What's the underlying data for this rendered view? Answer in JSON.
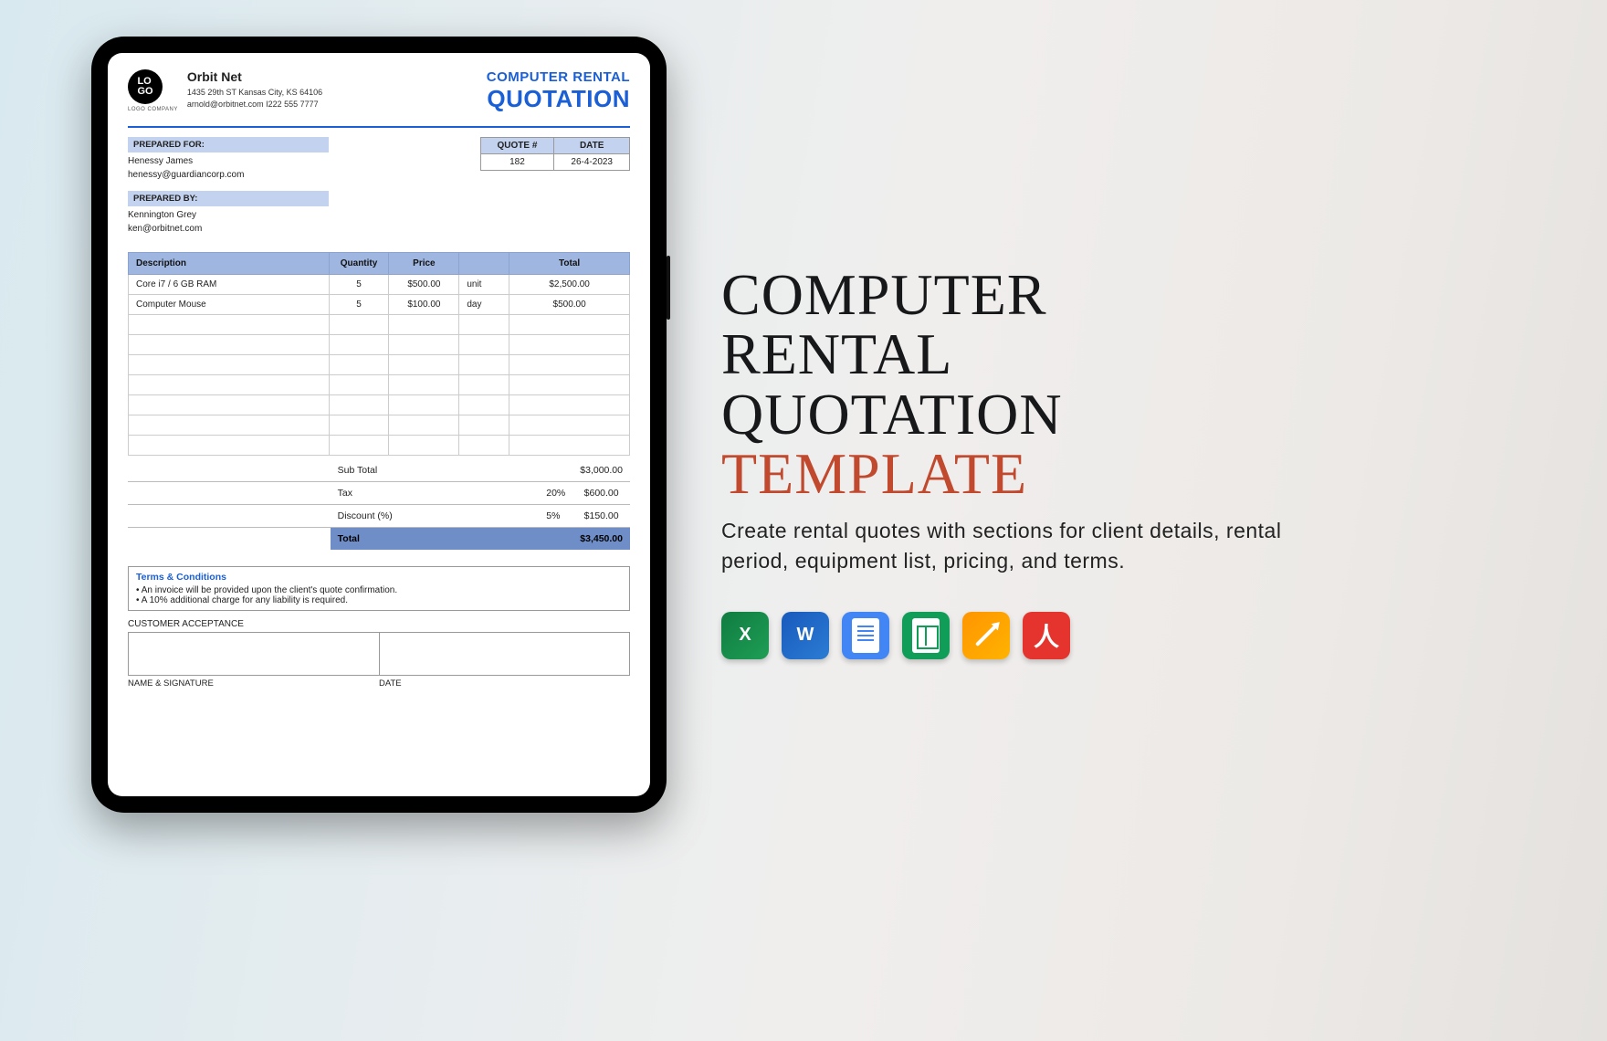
{
  "company": {
    "logo_top": "LO",
    "logo_bottom": "GO",
    "logo_caption": "LOGO COMPANY",
    "name": "Orbit Net",
    "address": "1435 29th ST Kansas City, KS 64106",
    "contact": "arnold@orbitnet.com I222 555 7777"
  },
  "title": {
    "small": "COMPUTER RENTAL",
    "big": "QUOTATION"
  },
  "prepared_for": {
    "label": "PREPARED FOR:",
    "name": "Henessy James",
    "email": "henessy@guardiancorp.com"
  },
  "prepared_by": {
    "label": "PREPARED BY:",
    "name": "Kennington Grey",
    "email": "ken@orbitnet.com"
  },
  "quote_box": {
    "quote_header": "QUOTE #",
    "date_header": "DATE",
    "quote_value": "182",
    "date_value": "26-4-2023"
  },
  "columns": {
    "description": "Description",
    "quantity": "Quantity",
    "price": "Price",
    "total": "Total"
  },
  "items": [
    {
      "description": "Core i7 / 6 GB RAM",
      "quantity": "5",
      "price": "$500.00",
      "unit": "unit",
      "total": "$2,500.00"
    },
    {
      "description": "Computer Mouse",
      "quantity": "5",
      "price": "$100.00",
      "unit": "day",
      "total": "$500.00"
    }
  ],
  "empty_rows": 7,
  "totals": {
    "subtotal_label": "Sub Total",
    "subtotal_value": "$3,000.00",
    "tax_label": "Tax",
    "tax_pct": "20%",
    "tax_value": "$600.00",
    "discount_label": "Discount (%)",
    "discount_pct": "5%",
    "discount_value": "$150.00",
    "grand_label": "Total",
    "grand_value": "$3,450.00"
  },
  "terms": {
    "title": "Terms & Conditions",
    "lines": [
      "• An invoice will be provided upon the client's quote confirmation.",
      "• A 10% additional charge for any liability is required."
    ]
  },
  "acceptance": {
    "header": "CUSTOMER ACCEPTANCE",
    "name_sig": "NAME & SIGNATURE",
    "date": "DATE"
  },
  "promo": {
    "line1": "COMPUTER",
    "line2": "RENTAL",
    "line3": "QUOTATION",
    "line4": "TEMPLATE",
    "description": "Create rental quotes with sections for client details, rental period, equipment list, pricing, and terms."
  },
  "apps": {
    "excel": "X",
    "word": "W",
    "pdf": "≻"
  }
}
